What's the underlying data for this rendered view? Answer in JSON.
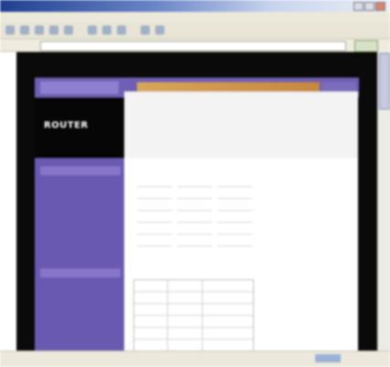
{
  "browser": {
    "window_title": "",
    "menu_items": [
      "",
      "",
      "",
      "",
      "",
      ""
    ],
    "address_value": "",
    "go_label": ""
  },
  "page": {
    "brand": "ROUTER",
    "nav_tab": "",
    "header_lines": [
      "",
      ""
    ],
    "sidebar_items": [
      {
        "label": "",
        "head": true
      },
      {
        "label": ""
      },
      {
        "label": ""
      },
      {
        "label": ""
      },
      {
        "label": ""
      },
      {
        "label": ""
      },
      {
        "label": ""
      },
      {
        "label": ""
      },
      {
        "label": "",
        "head": true
      },
      {
        "label": ""
      },
      {
        "label": ""
      },
      {
        "label": ""
      },
      {
        "label": ""
      },
      {
        "label": ""
      }
    ],
    "section1_title": "",
    "section1_rows": [
      [
        "",
        "",
        ""
      ],
      [
        "",
        "",
        ""
      ],
      [
        "",
        "",
        ""
      ],
      [
        "",
        "",
        ""
      ],
      [
        "",
        "",
        ""
      ],
      [
        "",
        "",
        ""
      ]
    ],
    "section2_title": "",
    "table_rows": [
      [
        "",
        "",
        ""
      ],
      [
        "",
        "",
        ""
      ],
      [
        "",
        "",
        ""
      ],
      [
        "",
        "",
        ""
      ],
      [
        "",
        "",
        ""
      ],
      [
        "",
        "",
        ""
      ]
    ]
  },
  "status": {
    "text": ""
  }
}
